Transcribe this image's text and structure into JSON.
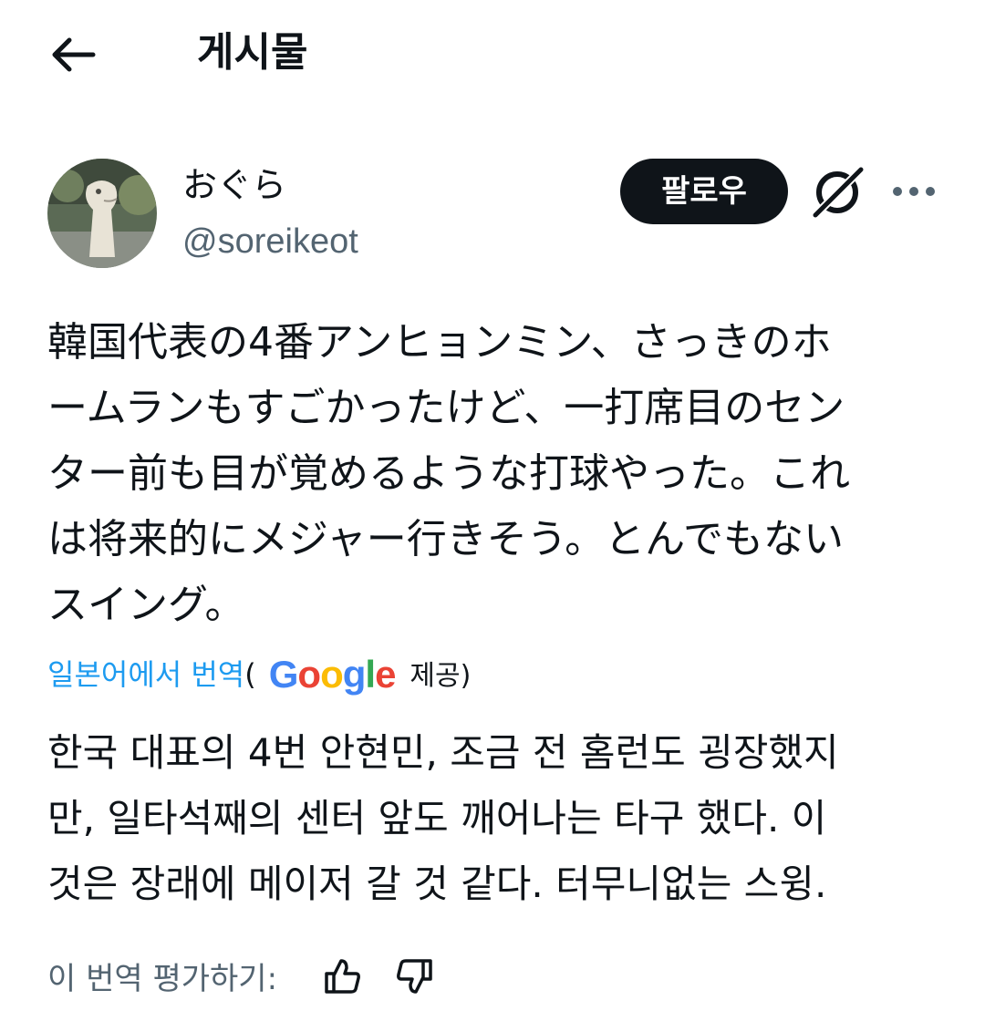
{
  "header": {
    "back_icon": "arrow-left-icon",
    "title": "게시물"
  },
  "author": {
    "display_name": "おぐら",
    "handle": "@soreikeot",
    "follow_label": "팔로우",
    "grok_icon": "grok-icon",
    "more_icon": "more-horizontal-icon"
  },
  "tweet": {
    "lines": [
      "韓国代表の4番アンヒョンミン、さっきのホ",
      "ームランもすごかったけど、一打席目のセン",
      "ター前も目が覚めるような打球やった。これ",
      "は将来的にメジャー行きそう。とんでもない",
      "スイング。"
    ]
  },
  "translation": {
    "link_label": "일본어에서 번역",
    "open_paren": "(",
    "provider": "Google",
    "provided_label": "제공)",
    "lines": [
      "한국 대표의 4번 안현민, 조금 전 홈런도 굉장했지",
      "만, 일타석째의 센터 앞도 깨어나는 타구 했다. 이",
      "것은 장래에 메이저 갈 것 같다. 터무니없는 스윙."
    ],
    "rate_label": "이 번역 평가하기:",
    "thumbs_up_icon": "thumbs-up-icon",
    "thumbs_down_icon": "thumbs-down-icon"
  },
  "colors": {
    "link": "#1d9bf0",
    "secondary_text": "#536471",
    "primary_text": "#0f1419"
  }
}
